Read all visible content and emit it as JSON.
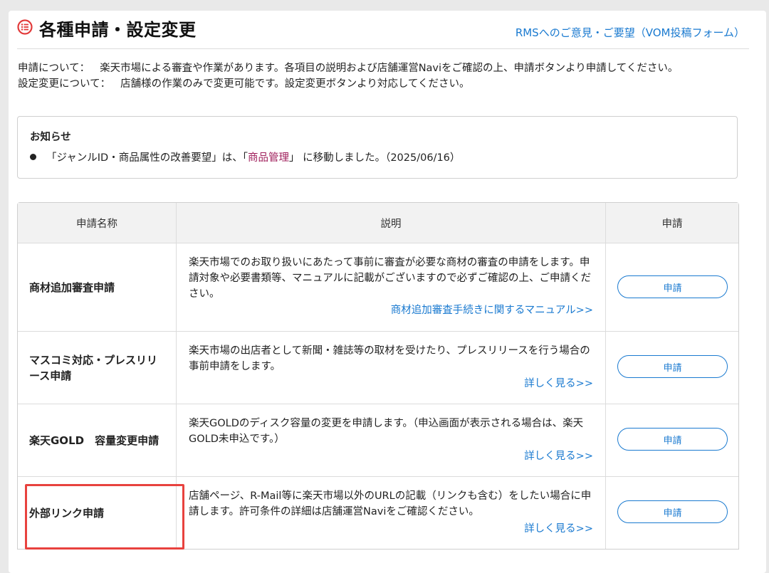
{
  "header": {
    "title": "各種申請・設定変更",
    "feedback_link": "RMSへのご意見・ご要望（VOM投稿フォーム）"
  },
  "intro": {
    "apply_label": "申請について：",
    "apply_text": "楽天市場による審査や作業があります。各項目の説明および店舗運営Naviをご確認の上、申請ボタンより申請してください。",
    "change_label": "設定変更について：",
    "change_text": "店舗様の作業のみで変更可能です。設定変更ボタンより対応してください。"
  },
  "notice": {
    "title": "お知らせ",
    "item_prefix": "「ジャンルID・商品属性の改善要望」は、「",
    "item_link": "商品管理",
    "item_suffix": "」 に移動しました。（2025/06/16）"
  },
  "table": {
    "headers": [
      "申請名称",
      "説明",
      "申請"
    ],
    "rows": [
      {
        "name": "商材追加審査申請",
        "description": "楽天市場でのお取り扱いにあたって事前に審査が必要な商材の審査の申請をします。申請対象や必要書類等、マニュアルに記載がございますので必ずご確認の上、ご申請ください。",
        "more": "商材追加審査手続きに関するマニュアル>>",
        "button": "申請"
      },
      {
        "name": "マスコミ対応・プレスリリース申請",
        "description": "楽天市場の出店者として新聞・雑誌等の取材を受けたり、プレスリリースを行う場合の事前申請をします。",
        "more": "詳しく見る>>",
        "button": "申請"
      },
      {
        "name": "楽天GOLD　容量変更申請",
        "description": "楽天GOLDのディスク容量の変更を申請します。（申込画面が表示される場合は、楽天GOLD未申込です。）",
        "more": "詳しく見る>>",
        "button": "申請"
      },
      {
        "name": "外部リンク申請",
        "description": "店舗ページ、R-Mail等に楽天市場以外のURLの記載（リンクも含む）をしたい場合に申請します。許可条件の詳細は店舗運営Naviをご確認ください。",
        "more": "詳しく見る>>",
        "button": "申請"
      }
    ]
  },
  "colors": {
    "accent_blue": "#1a7ad0",
    "icon_red": "#e23b3b",
    "notice_link": "#a0205c",
    "highlight_red": "#e8423e"
  }
}
